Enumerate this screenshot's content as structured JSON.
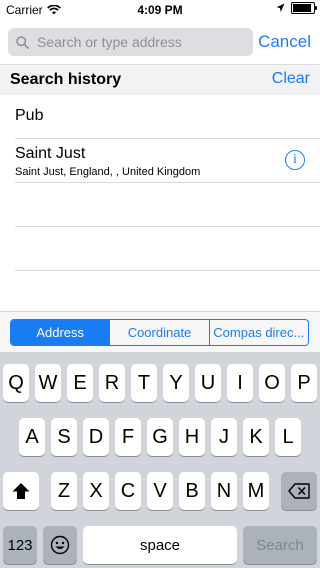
{
  "status_bar": {
    "carrier": "Carrier",
    "time": "4:09 PM",
    "battery_level": 0.95,
    "icons": [
      "wifi-icon",
      "location-arrow-icon",
      "battery-icon"
    ]
  },
  "search": {
    "placeholder": "Search or type address",
    "cancel_label": "Cancel"
  },
  "history": {
    "title": "Search history",
    "clear_label": "Clear",
    "items": [
      {
        "title": "Pub",
        "subtitle": ""
      },
      {
        "title": "Saint Just",
        "subtitle": "Saint Just, England, , United Kingdom",
        "info": "i"
      }
    ]
  },
  "segments": {
    "items": [
      "Address",
      "Coordinate",
      "Compas direc..."
    ],
    "selected": "Address"
  },
  "keyboard": {
    "row1": [
      "Q",
      "W",
      "E",
      "R",
      "T",
      "Y",
      "U",
      "I",
      "O",
      "P"
    ],
    "row2": [
      "A",
      "S",
      "D",
      "F",
      "G",
      "H",
      "J",
      "K",
      "L"
    ],
    "row3": [
      "Z",
      "X",
      "C",
      "V",
      "B",
      "N",
      "M"
    ],
    "numbers_label": "123",
    "space_label": "space",
    "search_label": "Search"
  },
  "colors": {
    "accent": "#1a7cf3",
    "keyboard_bg": "#d1d5db",
    "header_bg": "#f2f2f5"
  }
}
